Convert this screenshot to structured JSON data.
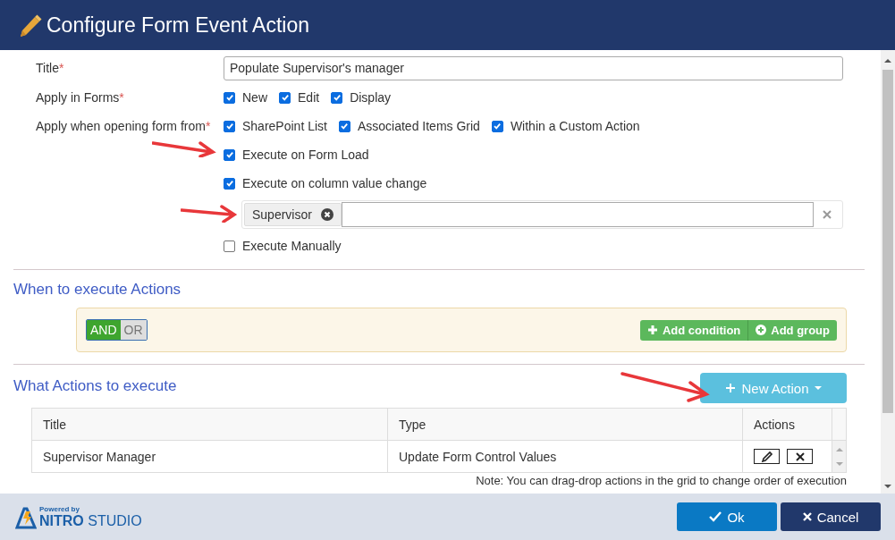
{
  "window": {
    "title": "Configure Form Event Action"
  },
  "form": {
    "title_field": {
      "label": "Title",
      "required_mark": "*",
      "value": "Populate Supervisor's manager"
    },
    "apply_in_forms": {
      "label": "Apply in Forms",
      "required_mark": "*",
      "options": [
        {
          "label": "New",
          "checked": true
        },
        {
          "label": "Edit",
          "checked": true
        },
        {
          "label": "Display",
          "checked": true
        }
      ]
    },
    "apply_when": {
      "label": "Apply when opening form from",
      "required_mark": "*",
      "options": [
        {
          "label": "SharePoint List",
          "checked": true
        },
        {
          "label": "Associated Items Grid",
          "checked": true
        },
        {
          "label": "Within a Custom Action",
          "checked": true
        }
      ]
    },
    "execute_options": [
      {
        "kind": "checkbox",
        "label": "Execute on Form Load",
        "checked": true
      },
      {
        "kind": "checkbox",
        "label": "Execute on column value change",
        "checked": true
      },
      {
        "kind": "tags",
        "tags": [
          "Supervisor"
        ]
      },
      {
        "kind": "checkbox",
        "label": "Execute Manually",
        "checked": false
      }
    ]
  },
  "conditions": {
    "heading": "When to execute Actions",
    "operators": [
      {
        "label": "AND",
        "selected": true
      },
      {
        "label": "OR",
        "selected": false
      }
    ],
    "buttons": [
      {
        "kind": "plus",
        "label": "Add condition"
      },
      {
        "kind": "circle-plus",
        "label": "Add group"
      }
    ]
  },
  "actions": {
    "heading": "What Actions to execute",
    "new_button": "New Action",
    "columns": [
      "Title",
      "Type",
      "Actions"
    ],
    "rows": [
      {
        "title": "Supervisor Manager",
        "type": "Update Form Control Values"
      }
    ],
    "note": "Note: You can drag-drop actions in the grid to change order of execution"
  },
  "footer": {
    "powered_by": "Powered by",
    "brand": "NITRO",
    "brand_suffix": "STUDIO",
    "buttons": [
      {
        "kind": "ok",
        "label": "Ok"
      },
      {
        "kind": "cancel",
        "label": "Cancel"
      }
    ]
  }
}
